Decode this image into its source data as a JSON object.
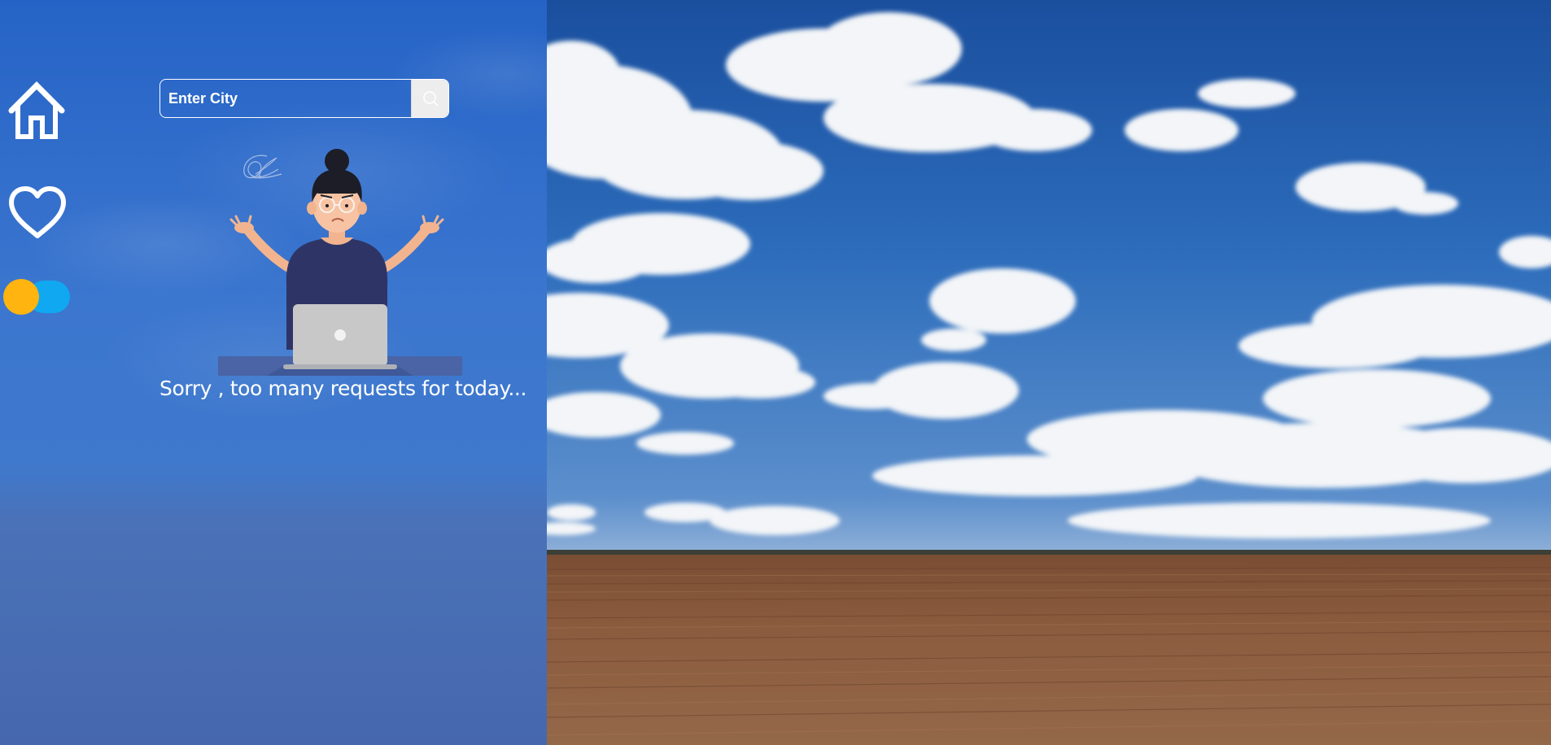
{
  "nav": {
    "home_icon": "home-icon",
    "favorites_icon": "heart-icon",
    "theme_toggle": {
      "knob_color": "#ffb40f",
      "track_color": "#10a8f0"
    }
  },
  "search": {
    "placeholder": "Enter City",
    "value": "",
    "button_icon": "search-icon"
  },
  "status": {
    "message": "Sorry , too many requests for today...",
    "illustration": "confused-woman-laptop"
  },
  "colors": {
    "panel_blue": "#2563c6",
    "sky": "#1e5bb3",
    "soil": "#8a5a3c"
  }
}
